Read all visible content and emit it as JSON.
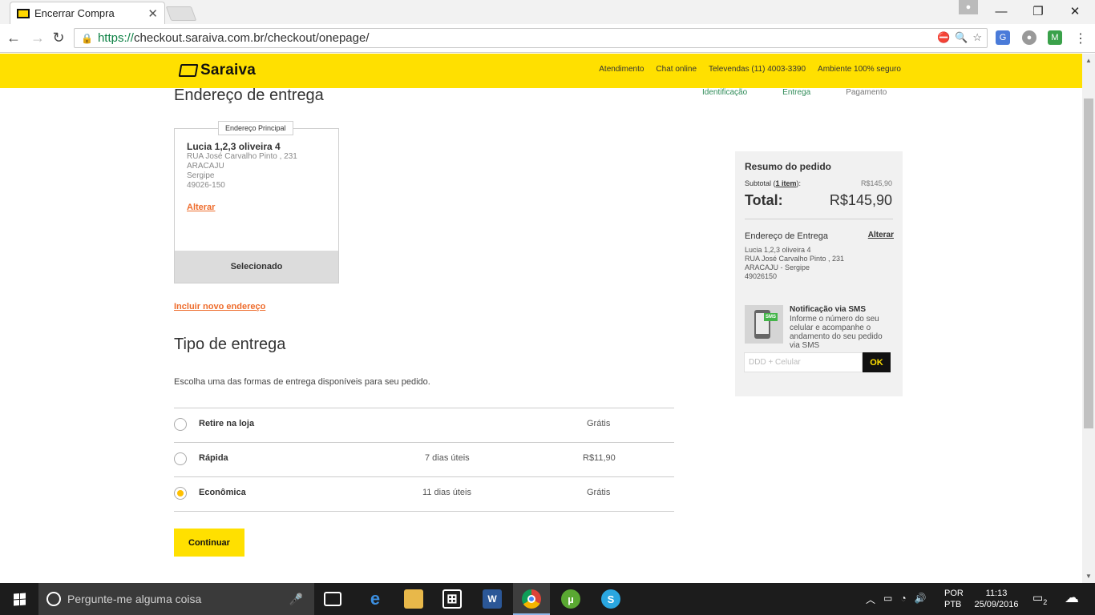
{
  "browser": {
    "tab_title": "Encerrar Compra",
    "tab_close": "✕",
    "url_https": "https://",
    "url_rest": "checkout.saraiva.com.br/checkout/onepage/",
    "win_min": "—",
    "win_max": "❐",
    "win_close": "✕"
  },
  "header": {
    "logo": "Saraiva",
    "links": [
      "Atendimento",
      "Chat online",
      "Televendas (11) 4003-3390",
      "Ambiente 100% seguro"
    ]
  },
  "steps": [
    {
      "label": "Identificação",
      "color": "#2e8b57"
    },
    {
      "label": "Entrega",
      "color": "#2e8b57"
    },
    {
      "label": "Pagamento",
      "color": "#777777"
    }
  ],
  "address": {
    "section_title": "Endereço de entrega",
    "tag": "Endereço Principal",
    "name": "Lucia 1,2,3 oliveira 4",
    "street": "RUA José Carvalho Pinto , 231",
    "city": "ARACAJU",
    "state": "Sergipe",
    "zip": "49026-150",
    "change_link": "Alterar",
    "selected_label": "Selecionado",
    "new_link": "Incluir novo endereço"
  },
  "delivery": {
    "section_title": "Tipo de entrega",
    "instructions": "Escolha uma das formas de entrega disponíveis para seu pedido.",
    "options": [
      {
        "name": "Retire na loja",
        "days": "",
        "price": "Grátis",
        "selected": false
      },
      {
        "name": "Rápida",
        "days": "7 dias úteis",
        "price": "R$11,90",
        "selected": false
      },
      {
        "name": "Econômica",
        "days": "11 dias úteis",
        "price": "Grátis",
        "selected": true
      }
    ],
    "continue_label": "Continuar"
  },
  "summary": {
    "title": "Resumo do pedido",
    "subtotal_prefix": "Subtotal (",
    "subtotal_items": "1 item",
    "subtotal_suffix": "):",
    "subtotal_value": "R$145,90",
    "total_label": "Total:",
    "total_value": "R$145,90",
    "address_title": "Endereço de Entrega",
    "address_change": "Alterar",
    "address_name": "Lucia 1,2,3 oliveira 4",
    "address_street": "RUA José Carvalho Pinto , 231",
    "address_city": "ARACAJU - Sergipe",
    "address_zip": "49026150",
    "sms_title": "Notificação via SMS",
    "sms_text": "Informe o número do seu celular e acompanhe o andamento do seu pedido via SMS",
    "sms_badge": "SMS",
    "sms_placeholder": "DDD + Celular",
    "sms_ok": "OK"
  },
  "taskbar": {
    "search_placeholder": "Pergunte-me alguma coisa",
    "lang_1": "POR",
    "lang_2": "PTB",
    "time": "11:13",
    "date": "25/09/2016",
    "notif_count": "2"
  }
}
